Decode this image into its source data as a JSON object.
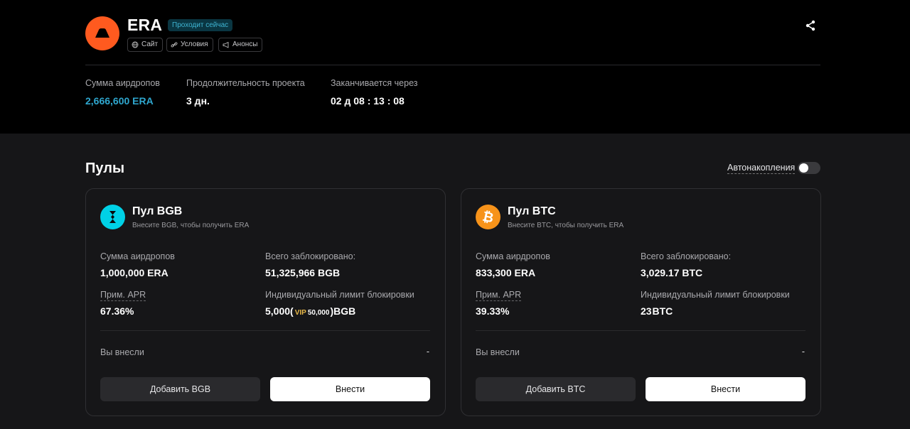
{
  "header": {
    "title": "ERA",
    "status_badge": "Проходит сейчас",
    "links": [
      {
        "label": "Сайт",
        "icon": "globe-icon"
      },
      {
        "label": "Условия",
        "icon": "link-icon"
      },
      {
        "label": "Анонсы",
        "icon": "megaphone-icon"
      }
    ],
    "share_icon": "share-icon"
  },
  "stats": [
    {
      "label": "Сумма аирдропов",
      "value": "2,666,600 ERA",
      "color": "#2fa7cf"
    },
    {
      "label": "Продолжительность проекта",
      "value": "3 дн.",
      "color": "#ffffff"
    },
    {
      "label": "Заканчивается через",
      "value": "02 д 08 : 13 : 08",
      "color": "#ffffff"
    }
  ],
  "pools_section": {
    "title": "Пулы",
    "autocompound_label": "Автонакопления",
    "autocompound_enabled": false
  },
  "pools": [
    {
      "name": "Пул BGB",
      "subtitle": "Внесите BGB, чтобы получить ERA",
      "icon": "bgb-coin-icon",
      "icon_color": "#00d1e6",
      "airdrop_label": "Сумма аирдропов",
      "airdrop_value": "1,000,000 ERA",
      "locked_label": "Всего заблокировано:",
      "locked_value": "51,325,966 BGB",
      "apr_label": "Прим. APR",
      "apr_value": "67.36%",
      "limit_label": "Индивидуальный лимит блокировки",
      "limit_value": "5,000",
      "limit_open": "(",
      "limit_vip_tag": "VIP",
      "limit_vip_amount": "50,000",
      "limit_close": ")",
      "limit_unit": "BGB",
      "deposited_label": "Вы внесли",
      "deposited_value": "-",
      "add_button": "Добавить BGB",
      "deposit_button": "Внести"
    },
    {
      "name": "Пул BTC",
      "subtitle": "Внесите BTC, чтобы получить ERA",
      "icon": "btc-coin-icon",
      "icon_color": "#f7931a",
      "airdrop_label": "Сумма аирдропов",
      "airdrop_value": "833,300 ERA",
      "locked_label": "Всего заблокировано:",
      "locked_value": "3,029.17 BTC",
      "apr_label": "Прим. APR",
      "apr_value": "39.33%",
      "limit_label": "Индивидуальный лимит блокировки",
      "limit_value": "23",
      "limit_unit": "BTC",
      "deposited_label": "Вы внесли",
      "deposited_value": "-",
      "add_button": "Добавить BTC",
      "deposit_button": "Внести"
    }
  ]
}
